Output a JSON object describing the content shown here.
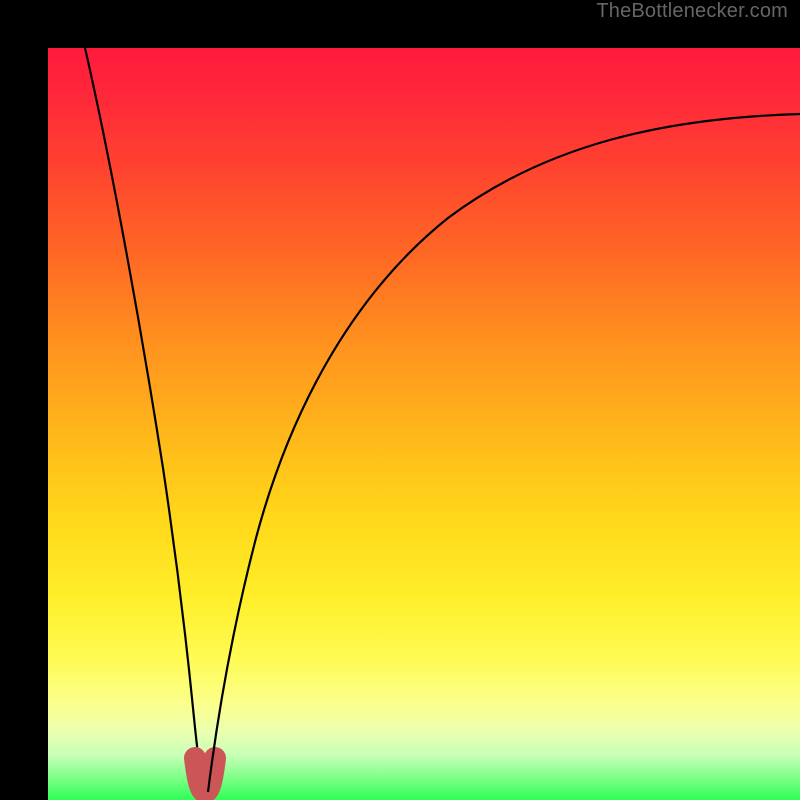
{
  "watermark": {
    "text": "TheBottlenecker.com"
  },
  "chart_data": {
    "type": "line",
    "title": "",
    "xlabel": "",
    "ylabel": "",
    "xlim": [
      0,
      100
    ],
    "ylim": [
      0,
      100
    ],
    "series": [
      {
        "name": "left-branch",
        "x": [
          5,
          7,
          9,
          11,
          13,
          15,
          17,
          18,
          19,
          19.8
        ],
        "y": [
          100,
          87,
          74,
          61,
          48,
          35,
          22,
          14,
          7,
          1
        ]
      },
      {
        "name": "right-branch",
        "x": [
          21.8,
          23,
          25,
          28,
          32,
          37,
          43,
          50,
          58,
          67,
          77,
          88,
          100
        ],
        "y": [
          1,
          9,
          21,
          35,
          48,
          59,
          68,
          75,
          80,
          84,
          87,
          89,
          90.5
        ]
      },
      {
        "name": "bottom-u-marker",
        "x": [
          19.0,
          19.6,
          20.2,
          20.8,
          21.4,
          22.2
        ],
        "y": [
          5.5,
          3.0,
          1.8,
          1.8,
          3.0,
          5.5
        ]
      }
    ],
    "colors": {
      "curve": "#000000",
      "marker": "#cc5557",
      "gradient_top": "#ff1a3c",
      "gradient_bottom": "#2dff57"
    }
  }
}
